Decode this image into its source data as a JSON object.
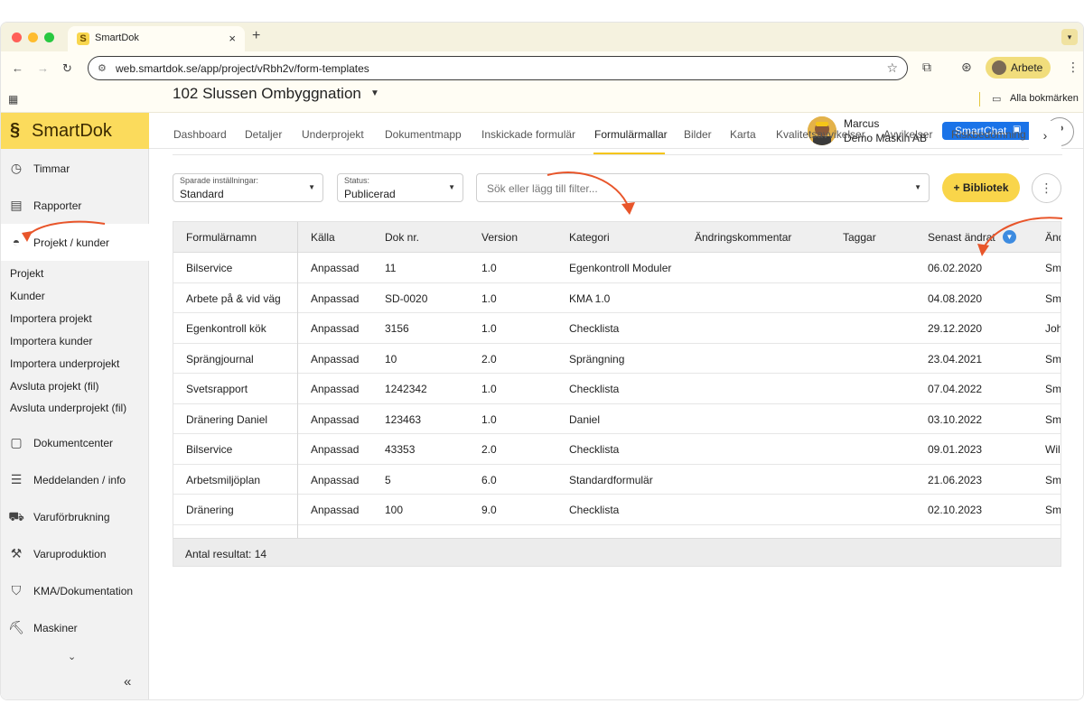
{
  "browser": {
    "tab_title": "SmartDok",
    "tab_close": "×",
    "new_tab": "+",
    "url": "web.smartdok.se/app/project/vRbh2v/form-templates",
    "profile_label": "Arbete",
    "bookmarks_label": "Alla bokmärken"
  },
  "app": {
    "logo_text": "SmartDok",
    "user": {
      "name": "Marcus",
      "org": "Demo Maskin AB"
    },
    "smartchat_label": "SmartChat",
    "help_label": "?"
  },
  "sidebar": {
    "items": [
      {
        "label": "Timmar",
        "icon": "clock-icon"
      },
      {
        "label": "Rapporter",
        "icon": "report-icon"
      },
      {
        "label": "Projekt / kunder",
        "icon": "helmet-icon"
      },
      {
        "label": "Dokumentcenter",
        "icon": "document-icon"
      },
      {
        "label": "Meddelanden / info",
        "icon": "message-icon"
      },
      {
        "label": "Varuförbrukning",
        "icon": "truck-icon"
      },
      {
        "label": "Varuproduktion",
        "icon": "production-icon"
      },
      {
        "label": "KMA/Dokumentation",
        "icon": "shield-icon"
      },
      {
        "label": "Maskiner",
        "icon": "excavator-icon"
      }
    ],
    "subitems": [
      "Projekt",
      "Kunder",
      "Importera projekt",
      "Importera kunder",
      "Importera underprojekt",
      "Avsluta projekt (fil)",
      "Avsluta underprojekt (fil)"
    ],
    "collapse_label": "«"
  },
  "project": {
    "title": "102 Slussen Ombyggnation",
    "tabs": [
      "Dashboard",
      "Detaljer",
      "Underprojekt",
      "Dokumentmapp",
      "Inskickade formulär",
      "Formulärmallar",
      "Bilder",
      "Karta",
      "Kvalitetsavvikelser",
      "Avvikelser",
      "Riskbedömning"
    ],
    "active_tab": "Formulärmallar"
  },
  "filters": {
    "saved": {
      "label": "Sparade inställningar:",
      "value": "Standard"
    },
    "status": {
      "label": "Status:",
      "value": "Publicerad"
    },
    "search_placeholder": "Sök eller lägg till filter...",
    "library_button": "+ Bibliotek",
    "more_label": "⋮"
  },
  "table": {
    "columns": [
      "Formulärnamn",
      "Källa",
      "Dok nr.",
      "Version",
      "Kategori",
      "Ändringskommentar",
      "Taggar",
      "Senast ändrat",
      "Änd"
    ],
    "rows": [
      [
        "Bilservice",
        "Anpassad",
        "11",
        "1.0",
        "Egenkontroll Moduler",
        "",
        "",
        "06.02.2020",
        "Sma"
      ],
      [
        "Arbete på & vid väg",
        "Anpassad",
        "SD-0020",
        "1.0",
        "KMA 1.0",
        "",
        "",
        "04.08.2020",
        "Sma"
      ],
      [
        "Egenkontroll kök",
        "Anpassad",
        "3156",
        "1.0",
        "Checklista",
        "",
        "",
        "29.12.2020",
        "Joh"
      ],
      [
        "Sprängjournal",
        "Anpassad",
        "10",
        "2.0",
        "Sprängning",
        "",
        "",
        "23.04.2021",
        "Sma"
      ],
      [
        "Svetsrapport",
        "Anpassad",
        "1242342",
        "1.0",
        "Checklista",
        "",
        "",
        "07.04.2022",
        "Sma"
      ],
      [
        "Dränering Daniel",
        "Anpassad",
        "123463",
        "1.0",
        "Daniel",
        "",
        "",
        "03.10.2022",
        "Sma"
      ],
      [
        "Bilservice",
        "Anpassad",
        "43353",
        "2.0",
        "Checklista",
        "",
        "",
        "09.01.2023",
        "Will"
      ],
      [
        "Arbetsmiljöplan",
        "Anpassad",
        "5",
        "6.0",
        "Standardformulär",
        "",
        "",
        "21.06.2023",
        "Sma"
      ],
      [
        "Dränering",
        "Anpassad",
        "100",
        "9.0",
        "Checklista",
        "",
        "",
        "02.10.2023",
        "Sma"
      ]
    ],
    "footer": "Antal resultat: 14"
  },
  "colors": {
    "brand_yellow": "#fbdb5c",
    "tab_underline": "#f5c518",
    "annotation_orange": "#e8552a",
    "smartchat_blue": "#1a73e8"
  }
}
